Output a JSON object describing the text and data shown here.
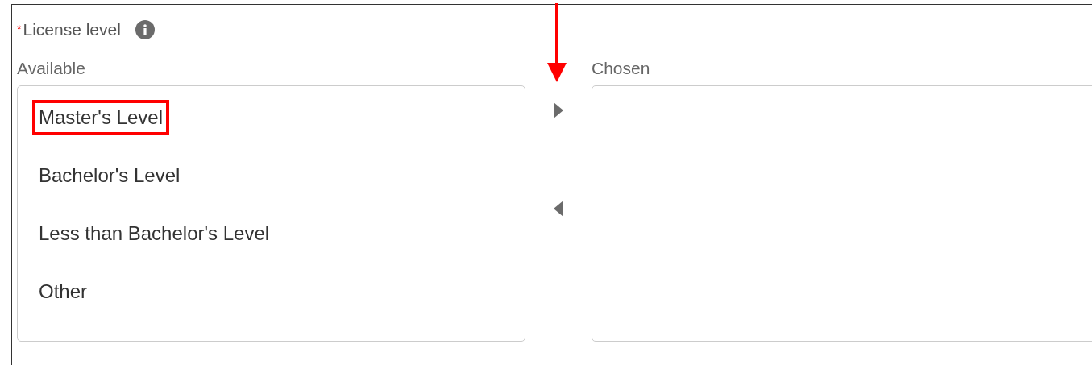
{
  "field": {
    "required_mark": "*",
    "label": "License level"
  },
  "available": {
    "label": "Available",
    "items": [
      {
        "text": "Master's Level",
        "highlighted": true
      },
      {
        "text": "Bachelor's Level",
        "highlighted": false
      },
      {
        "text": "Less than Bachelor's Level",
        "highlighted": false
      },
      {
        "text": "Other",
        "highlighted": false
      }
    ]
  },
  "chosen": {
    "label": "Chosen"
  }
}
